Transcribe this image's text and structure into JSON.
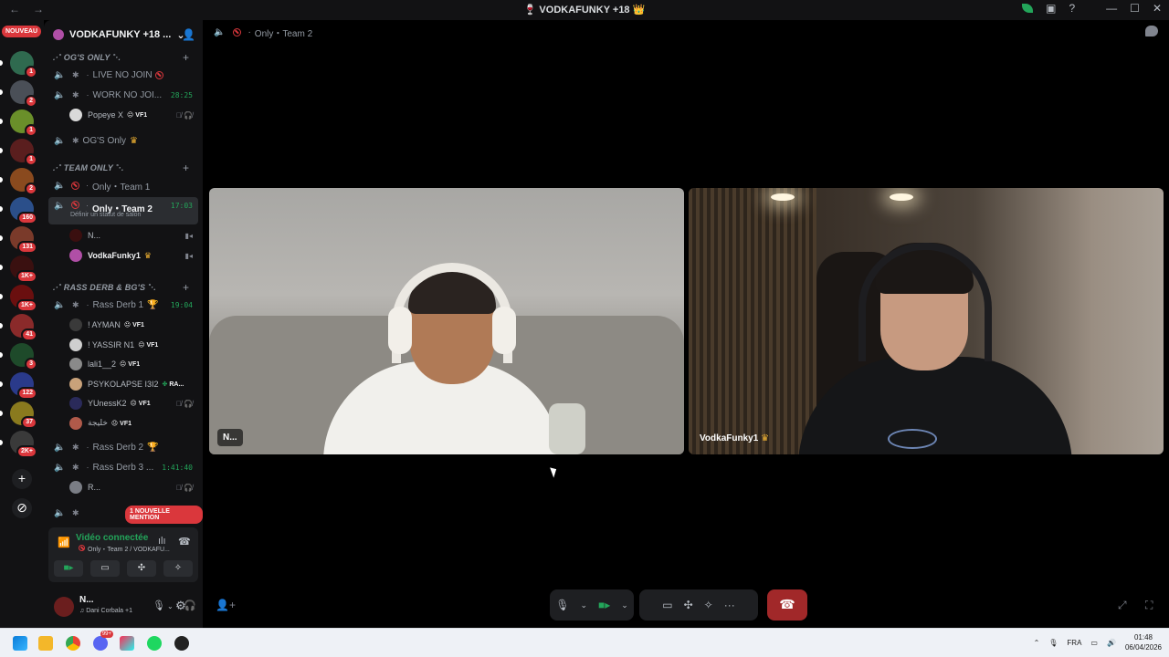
{
  "window": {
    "title": "VODKAFUNKY +18",
    "back": "←",
    "forward": "→",
    "controls": [
      "—",
      "☐",
      "✕"
    ]
  },
  "rail": {
    "new_badge": "NOUVEAU",
    "servers": [
      {
        "badge": "1",
        "color": "#2f6a4f"
      },
      {
        "badge": "2",
        "color": "#4a4f57"
      },
      {
        "badge": "1",
        "color": "#6a8f2a"
      },
      {
        "badge": "1",
        "color": "#5a1e1e"
      },
      {
        "badge": "2",
        "color": "#8a4a1e"
      },
      {
        "badge": "160",
        "color": "#2b4f8a"
      },
      {
        "badge": "131",
        "color": "#7a3a2a"
      },
      {
        "badge": "1K+",
        "color": "#3a1010"
      },
      {
        "badge": "1K+",
        "color": "#6a0f0f"
      },
      {
        "badge": "41",
        "color": "#8a2a2a"
      },
      {
        "badge": "3",
        "color": "#1e4a2a"
      },
      {
        "badge": "122",
        "color": "#2a3a8a"
      },
      {
        "badge": "37",
        "color": "#8a7a1e"
      },
      {
        "badge": "2K+",
        "color": "#3a3a3a"
      }
    ],
    "add_server": "+",
    "explore": "⊘"
  },
  "guild": {
    "name": "VODKAFUNKY +18 ...",
    "invite_icon": "add-member-icon"
  },
  "categories": [
    {
      "name": ".·˚ OG'S ONLY ˚·.",
      "plus": "+"
    },
    {
      "name": ".·˚ TEAM ONLY ˚·.",
      "plus": "+"
    },
    {
      "name": ".·˚ RASS DERB & BG'S ˚·.",
      "plus": "+"
    }
  ],
  "channels": {
    "live_no_join": {
      "name": "LIVE NO JOIN"
    },
    "work_no_join": {
      "name": "WORK NO JOI...",
      "time": "28:25"
    },
    "ogs_only": {
      "name": "OG'S Only"
    },
    "only_team1": {
      "name": "Only・Team 1"
    },
    "only_team2": {
      "name": "Only・Team 2",
      "time": "17:03",
      "status_hint": "Définir un statut de salon"
    },
    "rass_derb1": {
      "name": "Rass Derb 1",
      "time": "19:04"
    },
    "rass_derb2": {
      "name": "Rass Derb 2"
    },
    "rass_derb3": {
      "name": "Rass Derb 3 ...",
      "time": "1:41:40"
    }
  },
  "users": {
    "popeye": {
      "name": "Popeye X",
      "tag": "VF1"
    },
    "n": {
      "name": "N..."
    },
    "vodka": {
      "name": "VodkaFunky1"
    },
    "ayman": {
      "name": "! AYMAN",
      "tag": "VF1"
    },
    "yassir": {
      "name": "! YASSIR N1",
      "tag": "VF1"
    },
    "lali": {
      "name": "lali1__2",
      "tag": "VF1"
    },
    "psyko": {
      "name": "PSYKOLAPSE I3I2",
      "tag": "RA..."
    },
    "younessk2": {
      "name": "YUnessK2",
      "tag": "VF1"
    },
    "arabic": {
      "name": "خليجة",
      "tag": "VF1"
    },
    "r": {
      "name": "R..."
    }
  },
  "mention_badge": "1 NOUVELLE MENTION",
  "voice_panel": {
    "status": "Vidéo connectée",
    "channel": "Only・Team 2 / VODKAFU..."
  },
  "me": {
    "name": "N...",
    "activity": "Dani Corbala +1"
  },
  "stage": {
    "channel": "Only・Team 2",
    "tile1_label": "N...",
    "tile2_label": "VodkaFunky1"
  },
  "taskbar": {
    "lang": "FRA",
    "time": "01:48",
    "date": "06/04/2026",
    "discord_badge": "99+"
  }
}
